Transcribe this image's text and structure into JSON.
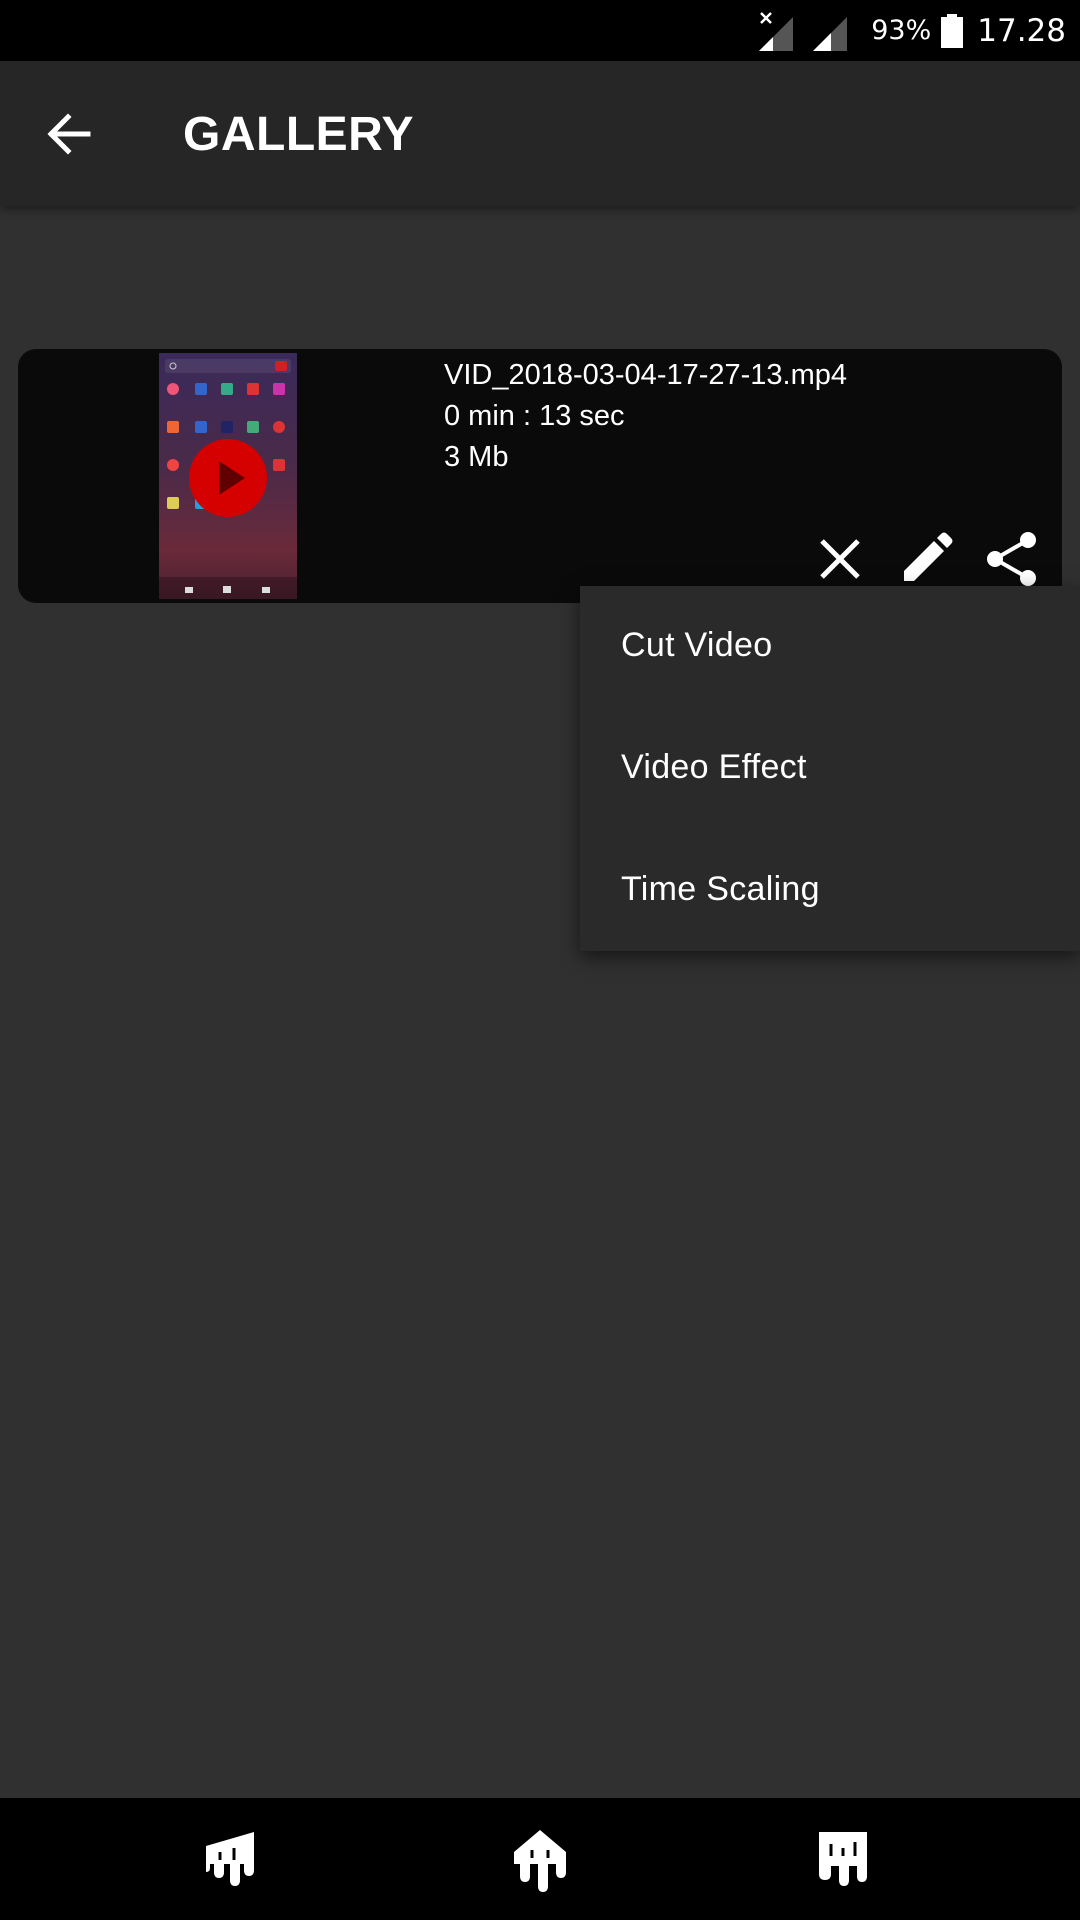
{
  "status_bar": {
    "battery_percent": "93%",
    "time": "17.28",
    "icons": [
      "signal-no-sim-icon",
      "signal-icon",
      "battery-icon"
    ]
  },
  "app_bar": {
    "title": "GALLERY",
    "back_icon": "arrow-left-icon"
  },
  "video_item": {
    "file_name": "VID_2018-03-04-17-27-13.mp4",
    "duration": "0 min : 13 sec",
    "size": "3 Mb",
    "actions": [
      "close-icon",
      "pencil-icon",
      "share-icon"
    ]
  },
  "edit_menu": {
    "items": [
      {
        "label": "Cut Video"
      },
      {
        "label": "Video Effect"
      },
      {
        "label": "Time Scaling"
      }
    ]
  },
  "bottom_nav": {
    "items": [
      "drip-icon-1",
      "drip-icon-2",
      "drip-icon-3"
    ]
  },
  "colors": {
    "background": "#303030",
    "app_bar": "#262626",
    "card": "#0a0a0a",
    "menu": "#2a2a2a",
    "play_button": "#d50000"
  }
}
